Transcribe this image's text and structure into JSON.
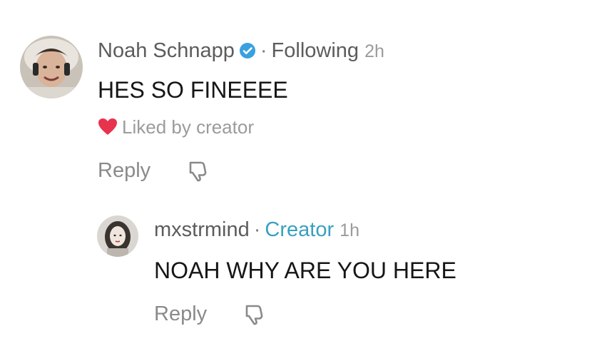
{
  "comments": [
    {
      "username": "Noah Schnapp",
      "verified": true,
      "separator": "·",
      "relation": "Following",
      "time": "2h",
      "text": "HES SO FINEEEE",
      "liked_label": "Liked by creator",
      "reply_label": "Reply",
      "avatar_icon": "avatar-noah",
      "heart_color": "#e8334e",
      "verified_color": "#3aa0e0"
    },
    {
      "username": "mxstrmind",
      "separator": "·",
      "relation": "Creator",
      "time": "1h",
      "text": "NOAH WHY ARE YOU HERE",
      "reply_label": "Reply",
      "avatar_icon": "avatar-mxstrmind",
      "relation_color": "#3aa0bf"
    }
  ]
}
